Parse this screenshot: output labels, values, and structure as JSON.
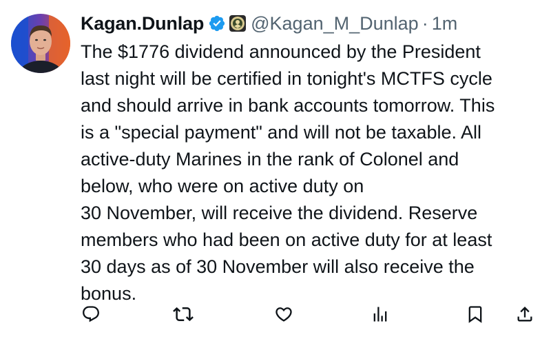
{
  "tweet": {
    "display_name": "Kagan.Dunlap",
    "handle": "@Kagan_M_Dunlap",
    "separator": "·",
    "timestamp": "1m",
    "verified_icon": "verified-badge-icon",
    "affiliate_icon": "marine-corps-affiliate-badge-icon",
    "text": "The $1776 dividend announced by the President\nlast night will be certified in tonight's MCTFS cycle\nand should arrive in bank accounts tomorrow. This\nis a \"special payment\" and will not be taxable. All\nactive-duty Marines in the rank of Colonel and\nbelow, who were on active duty on\n30 November, will receive the dividend. Reserve\nmembers who had been on active duty for at least\n30 days as of 30 November will also receive the\nbonus."
  },
  "actions": [
    {
      "name": "reply",
      "icon": "reply-icon"
    },
    {
      "name": "repost",
      "icon": "repost-icon"
    },
    {
      "name": "like",
      "icon": "heart-icon"
    },
    {
      "name": "views",
      "icon": "views-icon"
    },
    {
      "name": "bookmark",
      "icon": "bookmark-icon"
    },
    {
      "name": "share",
      "icon": "share-icon"
    }
  ],
  "colors": {
    "text": "#0f1419",
    "secondary": "#536471",
    "verified": "#1d9bf0"
  }
}
